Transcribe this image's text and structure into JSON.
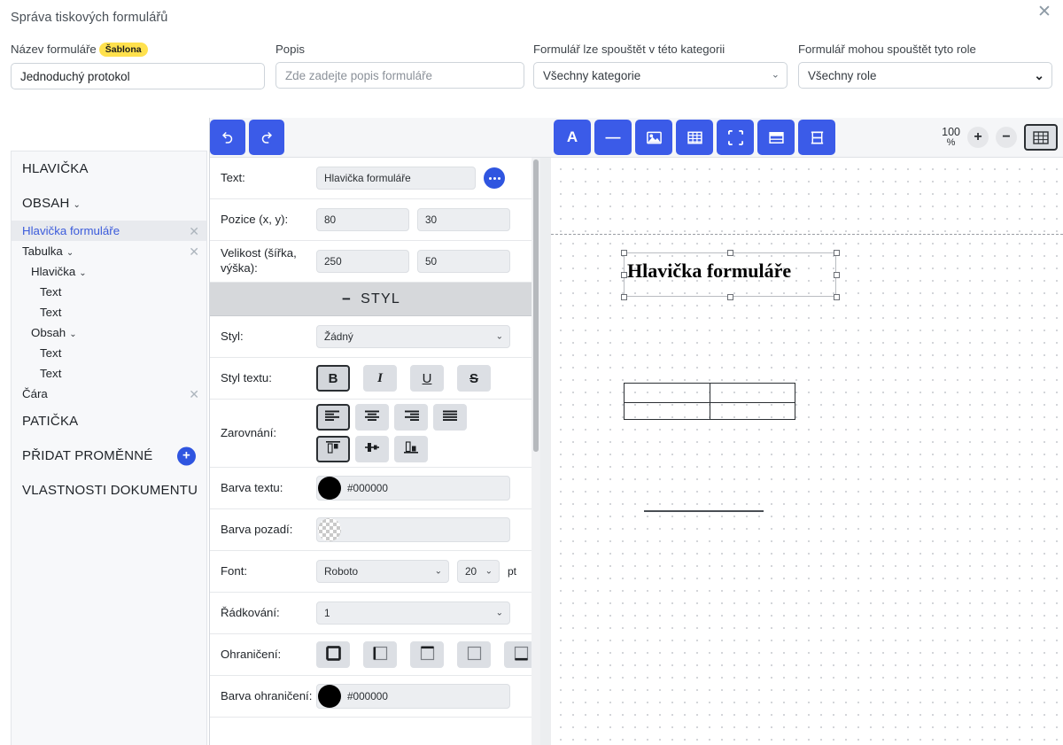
{
  "window": {
    "title": "Správa tiskových formulářů",
    "close_label": "✕"
  },
  "form_header": {
    "name_label": "Název formuláře",
    "name_badge": "Šablona",
    "name_value": "Jednoduchý protokol",
    "desc_label": "Popis",
    "desc_placeholder": "Zde zadejte popis formuláře",
    "desc_value": "",
    "category_label": "Formulář lze spouštět v této kategorii",
    "category_value": "Všechny kategorie",
    "roles_label": "Formulář mohou spouštět tyto role",
    "roles_value": "Všechny role"
  },
  "tree": {
    "header_section": "HLAVIČKA",
    "content_section": "OBSAH",
    "footer_section": "PATIČKA",
    "add_vars_section": "PŘIDAT PROMĚNNÉ",
    "doc_props_section": "VLASTNOSTI DOKUMENTU",
    "nodes": [
      {
        "label": "Hlavička formuláře",
        "indent": 0,
        "caret": false,
        "close": true,
        "selected": true
      },
      {
        "label": "Tabulka",
        "indent": 0,
        "caret": true,
        "close": true,
        "selected": false
      },
      {
        "label": "Hlavička",
        "indent": 1,
        "caret": true,
        "close": false,
        "selected": false
      },
      {
        "label": "Text",
        "indent": 2,
        "caret": false,
        "close": false,
        "selected": false
      },
      {
        "label": "Text",
        "indent": 2,
        "caret": false,
        "close": false,
        "selected": false
      },
      {
        "label": "Obsah",
        "indent": 1,
        "caret": true,
        "close": false,
        "selected": false
      },
      {
        "label": "Text",
        "indent": 2,
        "caret": false,
        "close": false,
        "selected": false
      },
      {
        "label": "Text",
        "indent": 2,
        "caret": false,
        "close": false,
        "selected": false
      },
      {
        "label": "Čára",
        "indent": 0,
        "caret": false,
        "close": true,
        "selected": false
      }
    ],
    "caret_glyph": "⌄",
    "close_glyph": "✕",
    "plus_glyph": "+"
  },
  "properties": {
    "undo_icon": "undo-arrow",
    "redo_icon": "redo-arrow",
    "text_label": "Text:",
    "text_value": "Hlavička formuláře",
    "position_label": "Pozice (x, y):",
    "position_x": "80",
    "position_y": "30",
    "size_label": "Velikost (šířka, výška):",
    "size_w": "250",
    "size_h": "50",
    "style_section": "STYL",
    "style_section_minus": "−",
    "style_label": "Styl:",
    "style_value": "Žádný",
    "text_style_label": "Styl textu:",
    "text_style_buttons": [
      {
        "name": "bold",
        "glyph": "B",
        "active": true
      },
      {
        "name": "italic",
        "glyph": "I",
        "active": false
      },
      {
        "name": "underline",
        "glyph": "U",
        "active": false
      },
      {
        "name": "strikethrough",
        "glyph": "S",
        "active": false
      }
    ],
    "align_label": "Zarovnání:",
    "align_h_buttons": [
      {
        "name": "align-left",
        "active": true
      },
      {
        "name": "align-center",
        "active": false
      },
      {
        "name": "align-right",
        "active": false
      },
      {
        "name": "align-justify",
        "active": false
      }
    ],
    "align_v_buttons": [
      {
        "name": "align-top",
        "active": true
      },
      {
        "name": "align-middle",
        "active": false
      },
      {
        "name": "align-bottom",
        "active": false
      }
    ],
    "text_color_label": "Barva textu:",
    "text_color_value": "#000000",
    "bg_color_label": "Barva pozadí:",
    "bg_color_value": "",
    "font_label": "Font:",
    "font_family_value": "Roboto",
    "font_size_value": "20",
    "font_unit": "pt",
    "line_height_label": "Řádkování:",
    "line_height_value": "1",
    "border_label": "Ohraničení:",
    "border_buttons": [
      {
        "name": "border-all",
        "active": false
      },
      {
        "name": "border-left",
        "active": false
      },
      {
        "name": "border-top",
        "active": false
      },
      {
        "name": "border-none",
        "active": false
      },
      {
        "name": "border-bottom",
        "active": false
      }
    ],
    "border_color_label": "Barva ohraničení:",
    "border_color_value": "#000000"
  },
  "canvas": {
    "tools": [
      {
        "name": "text-tool",
        "glyph": "A"
      },
      {
        "name": "line-tool",
        "glyph": "—"
      },
      {
        "name": "image-tool",
        "glyph": "image"
      },
      {
        "name": "table-tool",
        "glyph": "table"
      },
      {
        "name": "fullsize-tool",
        "glyph": "expand"
      },
      {
        "name": "rows-tool",
        "glyph": "rows"
      },
      {
        "name": "spacing-tool",
        "glyph": "spacing"
      }
    ],
    "zoom_value": "100",
    "zoom_unit": "%",
    "zoom_in": "+",
    "zoom_out": "−",
    "grid_toggle": "grid-icon",
    "page": {
      "header_text": "Hlavička formuláře",
      "table": {
        "rows": 2,
        "cols": 2
      },
      "line": {
        "name": "horizontal-rule"
      }
    }
  },
  "colors": {
    "accent_blue": "#3b5be8",
    "accent_blue_dark": "#2f55e0",
    "badge_yellow": "#ffe14d",
    "tree_selected_text": "#3b5bdb",
    "panel_bg": "#f7f8fa"
  }
}
